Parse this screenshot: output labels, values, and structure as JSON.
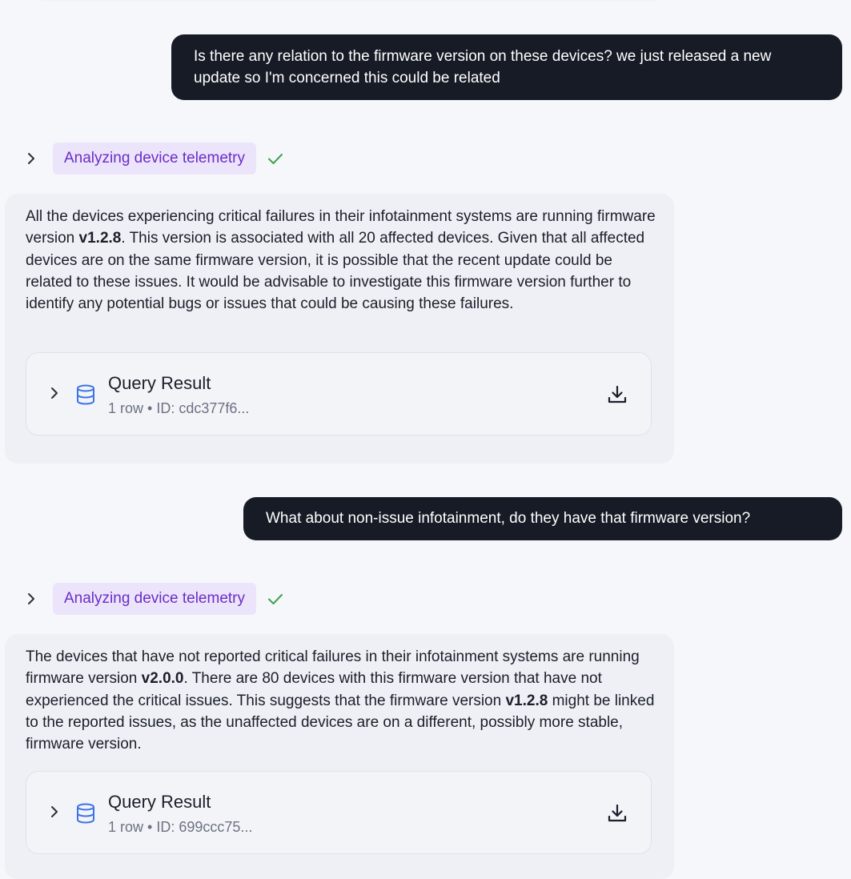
{
  "messages": {
    "user_1": "Is there any relation to the firmware version on these devices? we just released a new update so I'm concerned this could be related",
    "step_1": {
      "label": "Analyzing device telemetry",
      "status_icon": "check-icon",
      "expand_icon": "chevron-right-icon"
    },
    "answer_1": {
      "p1": "All the devices experiencing critical failures in their infotainment systems are running firmware version ",
      "v1": "v1.2.8",
      "p2": ". This version is associated with all 20 affected devices. Given that all affected devices are on the same firmware version, it is possible that the recent update could be related to these issues. It would be advisable to investigate this firmware version further to identify any potential bugs or issues that could be causing these failures."
    },
    "result_1": {
      "title": "Query Result",
      "meta": "1 row • ID: cdc377f6...",
      "icon": "database-icon",
      "action_icon": "download-icon"
    },
    "user_2": "What about non-issue infotainment, do they have that firmware version?",
    "step_2": {
      "label": "Analyzing device telemetry",
      "status_icon": "check-icon",
      "expand_icon": "chevron-right-icon"
    },
    "answer_2": {
      "p1": "The devices that have not reported critical failures in their infotainment systems are running firmware version ",
      "v1": "v2.0.0",
      "p2": ". There are 80 devices with this firmware version that have not experienced the critical issues. This suggests that the firmware version ",
      "v2": "v1.2.8",
      "p3": " might be linked to the reported issues, as the unaffected devices are on a different, possibly more stable, firmware version."
    },
    "result_2": {
      "title": "Query Result",
      "meta": "1 row • ID: 699ccc75...",
      "icon": "database-icon",
      "action_icon": "download-icon"
    }
  },
  "colors": {
    "background": "#f6f7fb",
    "user_bubble": "#171b26",
    "step_badge_bg": "#ece4fb",
    "step_badge_text": "#6a2ec7",
    "check": "#3fa34d",
    "db_icon": "#3b73e6"
  }
}
